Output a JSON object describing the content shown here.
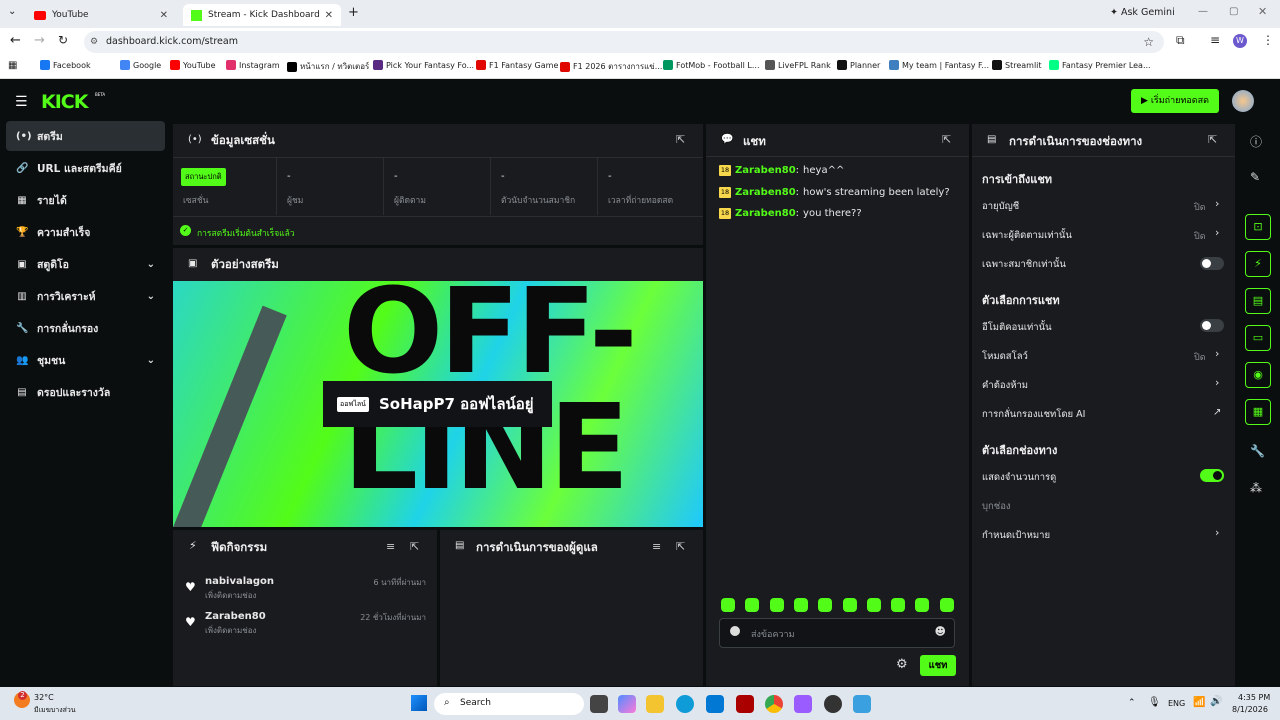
{
  "browser": {
    "tabs": [
      {
        "title": "YouTube"
      },
      {
        "title": "Stream - Kick Dashboard"
      }
    ],
    "new_tab": "+",
    "ask_gemini": "Ask Gemini",
    "url": "dashboard.kick.com/stream",
    "profile": "W",
    "bookmarks": [
      "Facebook",
      "Google",
      "YouTube",
      "Instagram",
      "หน้าแรก / ทวิตเตอร์",
      "Pick Your Fantasy Fo...",
      "F1 Fantasy Game",
      "F1 2026 ตารางการแข่...",
      "FotMob - Football L...",
      "LiveFPL Rank",
      "Planner",
      "My team | Fantasy F...",
      "Streamlit",
      "Fantasy Premier Lea..."
    ],
    "bookmark_colors": [
      "#1877f2",
      "#4285f4",
      "#ff0000",
      "#e1306c",
      "#000000",
      "#5a2a82",
      "#e10600",
      "#e10600",
      "#00985f",
      "#555555",
      "#111111",
      "#3f7fbf",
      "#111111",
      "#00ff85"
    ]
  },
  "header": {
    "logo": "KICK",
    "beta": "BETA",
    "go_live": "เริ่มถ่ายทอดสด"
  },
  "nav": [
    {
      "label": "สตรีม",
      "icon": "(•)",
      "active": true
    },
    {
      "label": "URL และสตรีมคีย์",
      "icon": "🔗"
    },
    {
      "label": "รายได้",
      "icon": "▦"
    },
    {
      "label": "ความสำเร็จ",
      "icon": "🏆"
    },
    {
      "label": "สตูดิโอ",
      "icon": "▣",
      "chevron": "⌄"
    },
    {
      "label": "การวิเคราะห์",
      "icon": "▥",
      "chevron": "⌄"
    },
    {
      "label": "การกลั่นกรอง",
      "icon": "🔧"
    },
    {
      "label": "ชุมชน",
      "icon": "👥",
      "chevron": "⌄"
    },
    {
      "label": "ดรอปและรางวัล",
      "icon": "▤"
    }
  ],
  "session": {
    "title": "ข้อมูลเซสชั่น",
    "status_badge": "สถานะปกติ",
    "stats": [
      {
        "value": "",
        "label": "เซสชั่น"
      },
      {
        "value": "-",
        "label": "ผู้ชม"
      },
      {
        "value": "-",
        "label": "ผู้ติดตาม"
      },
      {
        "value": "-",
        "label": "ตัวนับจำนวนสมาชิก"
      },
      {
        "value": "-",
        "label": "เวลาที่ถ่ายทอดสด"
      }
    ],
    "success": "การสตรีมเริ่มต้นสำเร็จแล้ว"
  },
  "preview": {
    "title": "ตัวอย่างสตรีม",
    "art_text": "OFF-\nLINE",
    "offline_tag": "ออฟไลน์",
    "offline_title": "SoHapP7 ออฟไลน์อยู่"
  },
  "activity": {
    "title": "ฟีดกิจกรรม",
    "items": [
      {
        "name": "nabivalagon",
        "sub": "เพิ่งติดตามช่อง",
        "time": "6 นาทีที่ผ่านมา"
      },
      {
        "name": "Zaraben80",
        "sub": "เพิ่งติดตามช่อง",
        "time": "22 ชั่วโมงที่ผ่านมา"
      }
    ]
  },
  "mod_actions": {
    "title": "การดำเนินการของผู้ดูแล"
  },
  "chat": {
    "title": "แชท",
    "messages": [
      {
        "badge": "18",
        "user": "Zaraben80",
        "text": "heya^^"
      },
      {
        "badge": "18",
        "user": "Zaraben80",
        "text": "how's streaming been lately?"
      },
      {
        "badge": "18",
        "user": "Zaraben80",
        "text": "you there??"
      }
    ],
    "input_placeholder": "ส่งข้อความ",
    "send": "แชท"
  },
  "channel": {
    "title": "การดำเนินการของช่องทาง",
    "chat_access_heading": "การเข้าถึงแชท",
    "rows1": [
      {
        "label": "อายุบัญชี",
        "value": "ปิด"
      },
      {
        "label": "เฉพาะผู้ติดตามเท่านั้น",
        "value": "ปิด"
      },
      {
        "label": "เฉพาะสมาชิกเท่านั้น"
      }
    ],
    "chat_options_heading": "ตัวเลือกการแชท",
    "rows2": [
      {
        "label": "อีโมติคอนเท่านั้น"
      },
      {
        "label": "โหมดสโลว์",
        "value": "ปิด"
      },
      {
        "label": "คำต้องห้าม"
      },
      {
        "label": "การกลั่นกรองแชทโดย AI"
      }
    ],
    "channel_options_heading": "ตัวเลือกช่องทาง",
    "rows3": [
      {
        "label": "แสดงจำนวนการดู"
      },
      {
        "label": "บุกช่อง"
      },
      {
        "label": "กำหนดเป้าหมาย"
      }
    ]
  },
  "taskbar": {
    "weather_temp": "32°C",
    "weather_desc": "มีเมฆบางส่วน",
    "weather_badge": "2",
    "search": "Search",
    "lang": "ENG",
    "time": "4:35 PM",
    "date": "8/1/2026"
  }
}
